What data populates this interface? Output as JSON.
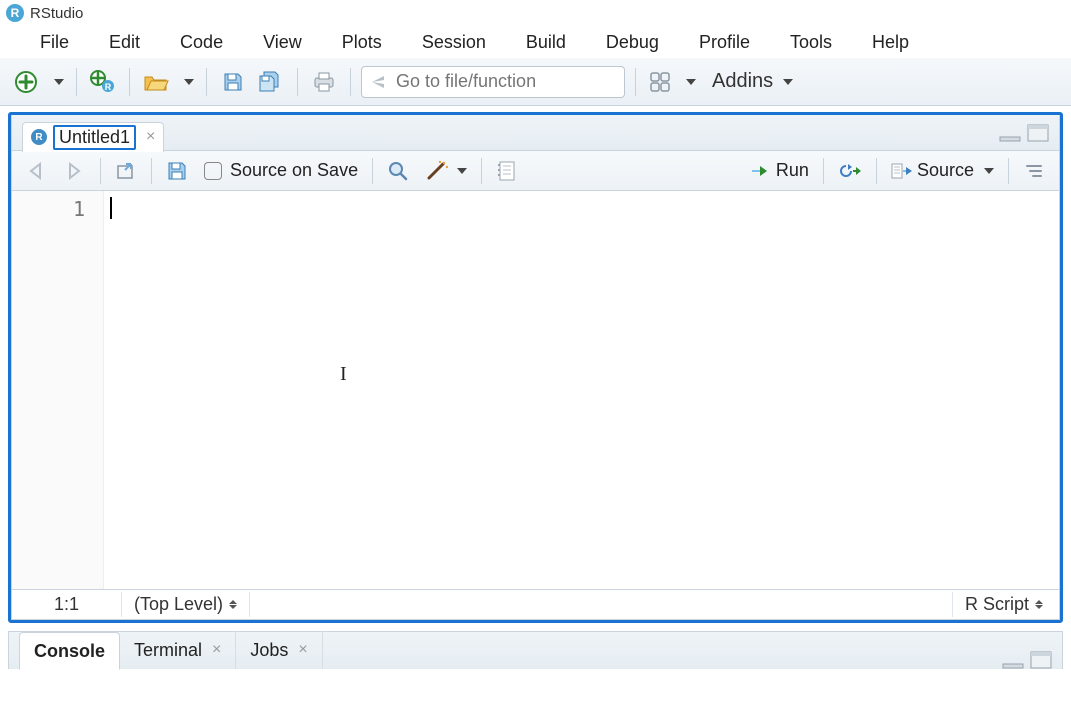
{
  "app": {
    "title": "RStudio",
    "iconLetter": "R"
  },
  "menubar": [
    "File",
    "Edit",
    "Code",
    "View",
    "Plots",
    "Session",
    "Build",
    "Debug",
    "Profile",
    "Tools",
    "Help"
  ],
  "toolbar": {
    "searchPlaceholder": "Go to file/function",
    "addins": "Addins"
  },
  "editor": {
    "tabName": "Untitled1",
    "sourceOnSave": "Source on Save",
    "run": "Run",
    "source": "Source",
    "lineNumber": "1",
    "cursorPos": "1:1",
    "scope": "(Top Level)",
    "fileType": "R Script"
  },
  "bottom": {
    "tabs": [
      {
        "label": "Console",
        "closable": false,
        "active": true
      },
      {
        "label": "Terminal",
        "closable": true,
        "active": false
      },
      {
        "label": "Jobs",
        "closable": true,
        "active": false
      }
    ]
  }
}
